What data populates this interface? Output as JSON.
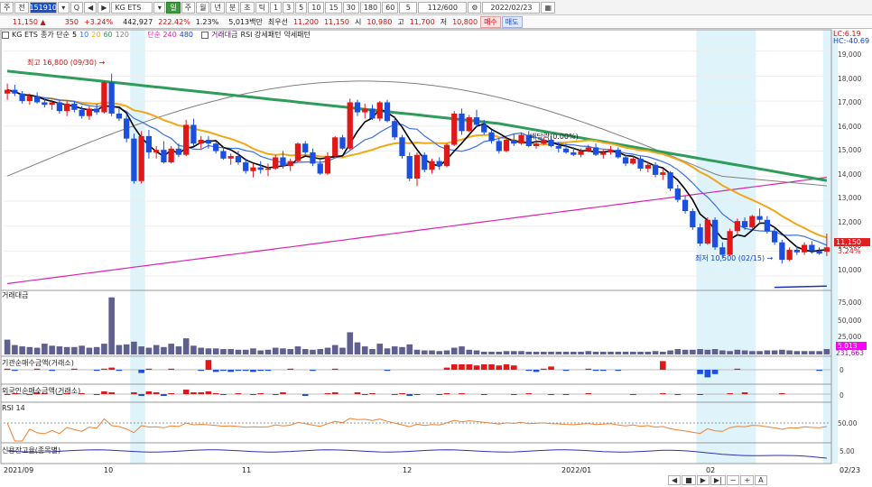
{
  "toolbar": {
    "btn_main": "주",
    "btn_jeon": "전",
    "code": "151910",
    "btn_q": "Q",
    "nav_left": "◀",
    "nav_right": "▶",
    "stock_name": "KG ETS",
    "btn_il": "일",
    "periods": [
      "주",
      "월",
      "년",
      "분",
      "초",
      "틱"
    ],
    "intervals": [
      "1",
      "3",
      "5",
      "10",
      "15",
      "30",
      "180",
      "60"
    ],
    "count": "5",
    "range": "112/600",
    "date": "2022/02/23"
  },
  "quote": {
    "price": "11,150",
    "arrow": "▲",
    "change": "350",
    "change_pct": "+3.24%",
    "volume": "442,927",
    "vol_ratio": "222.42%",
    "turnover_pct": "1.23%",
    "amount": "5,013백만",
    "bid_label": "최우선",
    "bid": "11,200",
    "ask": "11,150",
    "open_label": "시",
    "open": "10,980",
    "high_label": "고",
    "high": "11,700",
    "low_label": "저",
    "low": "10,800",
    "buy": "매수",
    "sell": "매도"
  },
  "legend": {
    "name": "KG ETS",
    "ma_label": "종가 단순",
    "ma_periods": [
      "5",
      "10",
      "20",
      "60",
      "120"
    ],
    "ma_colors": [
      "#000000",
      "#3a6ee8",
      "#f0a818",
      "#2e9c5a",
      "#808080"
    ],
    "ma_long_label": "종가 단순 240",
    "ma_long_period": "480",
    "ma_long_color": "#e020b0",
    "tags": [
      "거래대금",
      "RSI 강세패턴",
      "약세패턴"
    ]
  },
  "right_top": {
    "lc": "LC:6.19",
    "hc": "HC:-40.69"
  },
  "price_axis": [
    "19,000",
    "18,000",
    "17,000",
    "16,000",
    "15,000",
    "14,000",
    "13,000",
    "12,000",
    "11,000",
    "10,000"
  ],
  "price_tag": {
    "price": "11,150",
    "pct": "3.24%"
  },
  "annotations": {
    "high": "최고 16,800 (09/30)",
    "low": "최저 10,500 (02/15)",
    "dividend": "배당락(0.00%)"
  },
  "panels": {
    "volume": {
      "title": "거래대금",
      "axis": [
        "75,000",
        "50,000",
        "25,000"
      ],
      "tag": "5,013",
      "tag2": "231,663"
    },
    "inst": {
      "title": "기관순매수금액(거래소)",
      "axis": "0"
    },
    "foreign": {
      "title": "외국인순매수금액(거래소)",
      "axis": "0"
    },
    "rsi": {
      "title": "RSI 14",
      "axis": "50.00"
    },
    "credit": {
      "title": "신용잔고율(종목별)",
      "axis": "5.00"
    }
  },
  "date_axis": [
    "2021/09",
    "10",
    "11",
    "12",
    "2022/01",
    "02",
    "02/23"
  ],
  "bottom_nav": [
    "◀",
    "■",
    "▶",
    "▶|",
    "−",
    "+",
    "A"
  ],
  "chart_data": {
    "type": "candlestick",
    "ylim": [
      9500,
      19600
    ],
    "candles": [
      [
        17300,
        17700,
        17050,
        17450
      ],
      [
        17450,
        17650,
        17200,
        17300
      ],
      [
        17300,
        17400,
        16900,
        17000
      ],
      [
        17000,
        17300,
        16850,
        17200
      ],
      [
        17200,
        17350,
        16900,
        16950
      ],
      [
        16950,
        17100,
        16750,
        16850
      ],
      [
        16850,
        17050,
        16650,
        16950
      ],
      [
        16950,
        17050,
        16500,
        16600
      ],
      [
        16600,
        17000,
        16400,
        16900
      ],
      [
        16900,
        17000,
        16550,
        16650
      ],
      [
        16650,
        16800,
        16300,
        16400
      ],
      [
        16400,
        16800,
        16250,
        16700
      ],
      [
        16700,
        16900,
        16450,
        16550
      ],
      [
        16550,
        17800,
        16500,
        17750
      ],
      [
        17750,
        18100,
        16400,
        16500
      ],
      [
        16500,
        16700,
        16200,
        16300
      ],
      [
        16300,
        16500,
        15350,
        15500
      ],
      [
        15500,
        15700,
        13700,
        13800
      ],
      [
        13800,
        15800,
        13700,
        15600
      ],
      [
        15600,
        15850,
        14700,
        14950
      ],
      [
        14950,
        15200,
        14700,
        15050
      ],
      [
        15050,
        15400,
        14500,
        14550
      ],
      [
        14550,
        15200,
        14500,
        15100
      ],
      [
        15100,
        15300,
        14750,
        14850
      ],
      [
        14850,
        16250,
        14800,
        16050
      ],
      [
        16050,
        16300,
        15200,
        15300
      ],
      [
        15300,
        15600,
        15100,
        15450
      ],
      [
        15450,
        15600,
        15100,
        15300
      ],
      [
        15300,
        15400,
        14900,
        15000
      ],
      [
        15000,
        15200,
        14650,
        14700
      ],
      [
        14700,
        14900,
        14450,
        14800
      ],
      [
        14800,
        15000,
        14450,
        14550
      ],
      [
        14550,
        14700,
        14100,
        14200
      ],
      [
        14200,
        14500,
        13950,
        14350
      ],
      [
        14350,
        14600,
        14100,
        14250
      ],
      [
        14250,
        14500,
        14000,
        14300
      ],
      [
        14300,
        14850,
        14250,
        14750
      ],
      [
        14750,
        15000,
        14300,
        14400
      ],
      [
        14400,
        14700,
        14200,
        14600
      ],
      [
        14600,
        15350,
        14550,
        15300
      ],
      [
        15300,
        15400,
        14850,
        14950
      ],
      [
        14950,
        15100,
        14400,
        14500
      ],
      [
        14500,
        14650,
        14050,
        14100
      ],
      [
        14100,
        14950,
        14050,
        14800
      ],
      [
        14800,
        15600,
        14750,
        15550
      ],
      [
        15550,
        15650,
        15050,
        15100
      ],
      [
        15100,
        17100,
        15050,
        16950
      ],
      [
        16950,
        17050,
        16400,
        16550
      ],
      [
        16550,
        16900,
        16300,
        16700
      ],
      [
        16700,
        16850,
        16250,
        16300
      ],
      [
        16300,
        17000,
        16200,
        16950
      ],
      [
        16950,
        17050,
        16150,
        16200
      ],
      [
        16200,
        16400,
        15450,
        15550
      ],
      [
        15550,
        15650,
        14700,
        14800
      ],
      [
        14800,
        14950,
        13800,
        13900
      ],
      [
        13900,
        14950,
        13600,
        14850
      ],
      [
        14850,
        14950,
        14150,
        14250
      ],
      [
        14250,
        14700,
        14100,
        14600
      ],
      [
        14600,
        14750,
        14250,
        14400
      ],
      [
        14400,
        15300,
        14350,
        15250
      ],
      [
        15250,
        16600,
        15200,
        16500
      ],
      [
        16500,
        16700,
        15650,
        15800
      ],
      [
        15800,
        16450,
        15750,
        16350
      ],
      [
        16350,
        16650,
        15950,
        16050
      ],
      [
        16050,
        16250,
        15650,
        15750
      ],
      [
        15750,
        15850,
        15300,
        15400
      ],
      [
        15400,
        15500,
        14900,
        15000
      ],
      [
        15000,
        15550,
        14950,
        15450
      ],
      [
        15450,
        15700,
        15200,
        15300
      ],
      [
        15300,
        15750,
        15250,
        15650
      ],
      [
        15650,
        15800,
        15150,
        15200
      ],
      [
        15200,
        15450,
        15100,
        15300
      ],
      [
        15300,
        15550,
        15250,
        15450
      ],
      [
        15450,
        15600,
        15150,
        15200
      ],
      [
        15200,
        15350,
        14950,
        15100
      ],
      [
        15100,
        15300,
        14900,
        14950
      ],
      [
        14950,
        15150,
        14800,
        14850
      ],
      [
        14850,
        15100,
        14750,
        15000
      ],
      [
        15000,
        15250,
        14950,
        15150
      ],
      [
        15150,
        15300,
        14800,
        14850
      ],
      [
        14850,
        15050,
        14700,
        14950
      ],
      [
        14950,
        15200,
        14850,
        15050
      ],
      [
        15050,
        15150,
        14700,
        14750
      ],
      [
        14750,
        14850,
        14400,
        14500
      ],
      [
        14500,
        14800,
        14450,
        14700
      ],
      [
        14700,
        14800,
        14200,
        14300
      ],
      [
        14300,
        14550,
        14150,
        14450
      ],
      [
        14450,
        14550,
        13950,
        14050
      ],
      [
        14050,
        14300,
        13850,
        14150
      ],
      [
        14150,
        14200,
        13400,
        13500
      ],
      [
        13500,
        13650,
        12950,
        13050
      ],
      [
        13050,
        13200,
        12500,
        12600
      ],
      [
        12600,
        12700,
        11850,
        11950
      ],
      [
        11950,
        12100,
        11200,
        11300
      ],
      [
        11300,
        12350,
        11250,
        12250
      ],
      [
        12250,
        12350,
        11050,
        11150
      ],
      [
        11150,
        11350,
        10700,
        10850
      ],
      [
        10850,
        11900,
        10800,
        11800
      ],
      [
        11800,
        12300,
        11700,
        12200
      ],
      [
        12200,
        12350,
        11850,
        11950
      ],
      [
        11950,
        12450,
        11900,
        12400
      ],
      [
        12400,
        12700,
        12100,
        12250
      ],
      [
        12250,
        12400,
        11700,
        11800
      ],
      [
        11800,
        11900,
        11250,
        11350
      ],
      [
        11350,
        11450,
        10500,
        10650
      ],
      [
        10650,
        11150,
        10600,
        11050
      ],
      [
        11050,
        11200,
        10850,
        10950
      ],
      [
        10950,
        11350,
        10850,
        11250
      ],
      [
        11250,
        11400,
        10900,
        11000
      ],
      [
        11000,
        11150,
        10850,
        10900
      ],
      [
        10980,
        11700,
        10800,
        11150
      ]
    ],
    "volume": [
      22,
      14,
      12,
      11,
      10,
      16,
      13,
      12,
      11,
      11,
      13,
      10,
      11,
      16,
      85,
      14,
      15,
      19,
      12,
      10,
      14,
      11,
      16,
      12,
      24,
      13,
      10,
      9,
      9,
      8,
      8,
      7,
      7,
      9,
      6,
      7,
      10,
      9,
      8,
      12,
      8,
      7,
      8,
      10,
      14,
      10,
      33,
      18,
      12,
      8,
      16,
      9,
      12,
      11,
      15,
      7,
      6,
      6,
      5,
      6,
      10,
      12,
      7,
      6,
      4,
      4,
      4,
      5,
      5,
      5,
      4,
      4,
      4,
      4,
      4,
      4,
      4,
      4,
      5,
      4,
      4,
      4,
      4,
      4,
      4,
      4,
      4,
      5,
      4,
      6,
      8,
      7,
      7,
      8,
      7,
      8,
      6,
      5,
      7,
      6,
      5,
      5,
      6,
      6,
      7,
      6,
      5,
      5,
      5,
      5,
      8
    ],
    "inst": [
      1,
      -1,
      0,
      0,
      1,
      0,
      -1,
      0,
      0,
      1,
      0,
      0,
      -1,
      1,
      2,
      -1,
      0,
      0,
      -3,
      1,
      0,
      0,
      1,
      0,
      0,
      0,
      -1,
      9,
      -2,
      -1,
      -2,
      -1,
      -1,
      -2,
      -1,
      -1,
      0,
      0,
      1,
      0,
      0,
      -1,
      0,
      0,
      1,
      0,
      0,
      0,
      0,
      0,
      0,
      -1,
      0,
      0,
      0,
      0,
      0,
      0,
      0,
      2,
      5,
      5,
      5,
      4,
      5,
      5,
      4,
      5,
      4,
      0,
      -1,
      -2,
      1,
      3,
      0,
      -1,
      0,
      0,
      1,
      -1,
      -1,
      0,
      -1,
      0,
      0,
      0,
      0,
      0,
      8,
      0,
      0,
      0,
      0,
      -4,
      -7,
      -4,
      0,
      0,
      1,
      0,
      0,
      0,
      0,
      0,
      0,
      0,
      0,
      0,
      0,
      -1
    ],
    "foreign": [
      -1,
      1,
      0,
      -1,
      2,
      1,
      0,
      -1,
      1,
      0,
      1,
      0,
      -1,
      3,
      2,
      0,
      0,
      2,
      -2,
      3,
      2,
      -2,
      1,
      0,
      5,
      2,
      2,
      3,
      1,
      -1,
      0,
      1,
      0,
      -1,
      1,
      0,
      -1,
      2,
      0,
      0,
      -2,
      0,
      0,
      1,
      2,
      0,
      0,
      2,
      -1,
      1,
      0,
      0,
      -1,
      1,
      -2,
      -1,
      0,
      0,
      -1,
      1,
      0,
      1,
      0,
      0,
      -1,
      0,
      0,
      0,
      -1,
      0,
      1,
      0,
      0,
      -1,
      0,
      -1,
      0,
      0,
      1,
      0,
      0,
      0,
      0,
      0,
      -1,
      0,
      0,
      0,
      1,
      0,
      -1,
      0,
      0,
      -1,
      0,
      0,
      0,
      1,
      0,
      2,
      0,
      0,
      0,
      0,
      1,
      0,
      0,
      0,
      0,
      0,
      0
    ],
    "highlight_zones": [
      [
        17,
        18
      ],
      [
        93,
        100
      ],
      [
        110,
        111
      ]
    ]
  }
}
